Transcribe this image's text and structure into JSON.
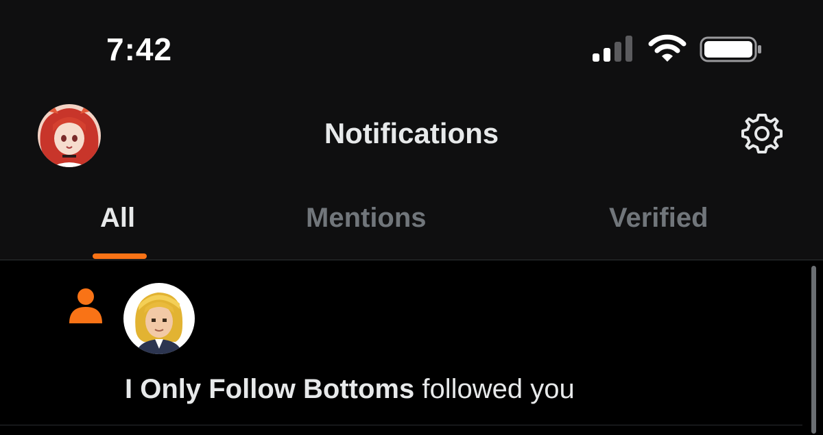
{
  "status_bar": {
    "time": "7:42",
    "icons": [
      "signal-icon",
      "wifi-icon",
      "battery-icon"
    ]
  },
  "header": {
    "title": "Notifications",
    "avatar_icon": "profile-avatar",
    "settings_icon": "gear-icon"
  },
  "tabs": [
    {
      "label": "All",
      "active": true
    },
    {
      "label": "Mentions",
      "active": false
    },
    {
      "label": "Verified",
      "active": false
    }
  ],
  "notifications": [
    {
      "type_icon": "person-icon",
      "user": "I Only Follow Bottoms",
      "action": "followed you"
    }
  ],
  "colors": {
    "accent": "#f97316",
    "background": "#000000",
    "header_background": "#0f0f10",
    "text_primary": "#e7e9ea",
    "text_secondary": "#71767b"
  }
}
